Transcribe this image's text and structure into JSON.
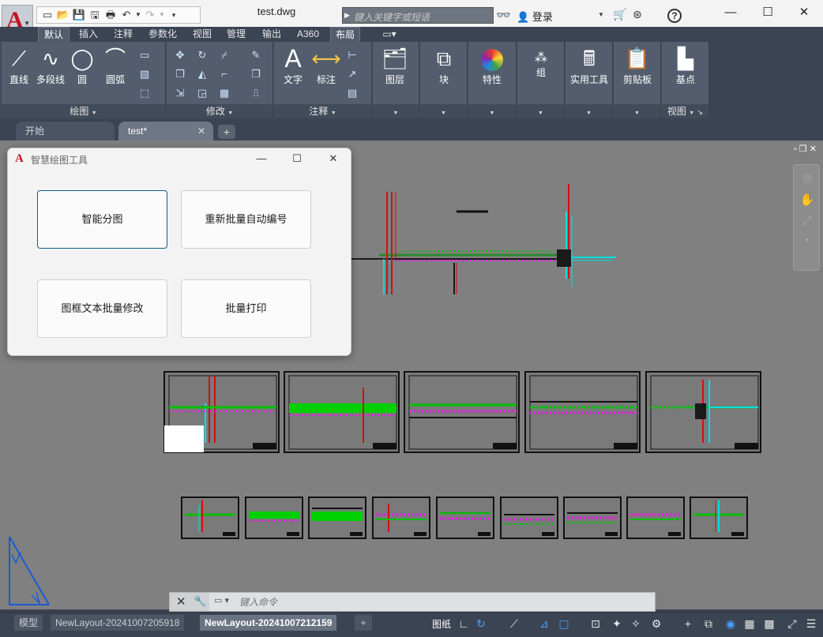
{
  "titlebar": {
    "document_title": "test.dwg",
    "search_placeholder": "键入关键字或短语",
    "login_label": "登录",
    "help_label": "?"
  },
  "ribbon_tabs": [
    "默认",
    "插入",
    "注释",
    "参数化",
    "视图",
    "管理",
    "输出",
    "A360",
    "布局"
  ],
  "ribbon": {
    "draw_panel": {
      "title": "绘图",
      "tools": [
        "直线",
        "多段线",
        "圆",
        "圆弧"
      ]
    },
    "modify_panel": {
      "title": "修改"
    },
    "annotation_panel": {
      "title": "注释",
      "tools": [
        "文字",
        "标注"
      ]
    },
    "layers_label": "图层",
    "block_label": "块",
    "properties_label": "特性",
    "groups_label": "组",
    "utilities_label": "实用工具",
    "clipboard_label": "剪贴板",
    "view_panel": {
      "tool": "基点",
      "title": "视图"
    }
  },
  "doc_tabs": {
    "start": "开始",
    "active": "test*"
  },
  "dialog": {
    "title": "智慧绘图工具",
    "buttons": [
      "智能分图",
      "重新批量自动编号",
      "图框文本批量修改",
      "批量打印"
    ]
  },
  "command": {
    "placeholder": "键入命令"
  },
  "statusbar": {
    "layout_tabs": [
      "模型",
      "NewLayout-20241007205918",
      "NewLayout-20241007212159"
    ],
    "active_layout_index": 2,
    "paper_label": "图纸"
  },
  "colors": {
    "accent": "#0b5f8a",
    "brand": "#c1121f",
    "canvas": "#808080",
    "chrome": "#3b4453"
  }
}
